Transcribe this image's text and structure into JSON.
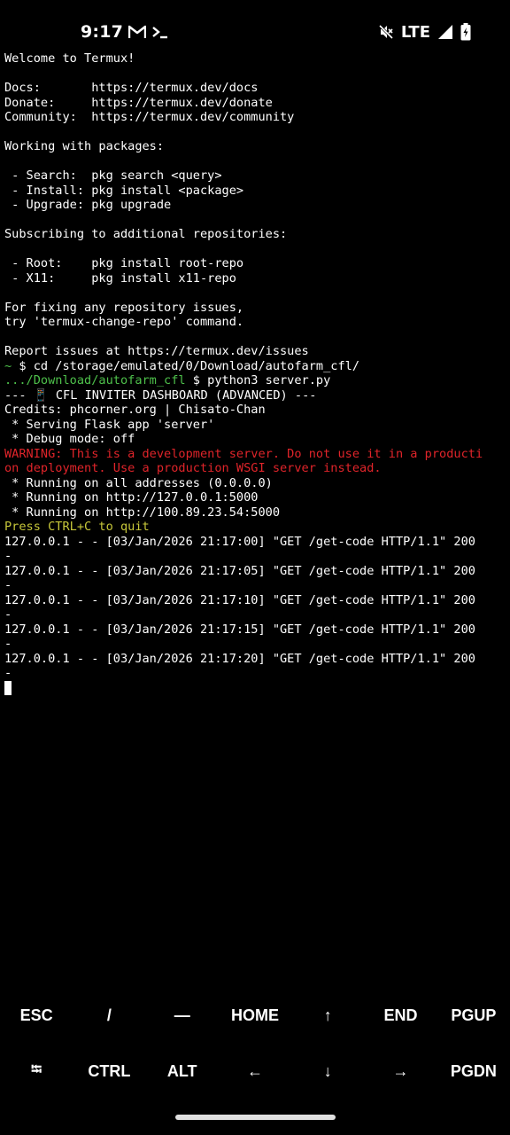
{
  "status_bar": {
    "time": "9:17",
    "network": "LTE",
    "icons": [
      "gmail-icon",
      "terminal-icon",
      "mute-icon",
      "signal-icon",
      "battery-charging-icon"
    ]
  },
  "terminal": {
    "lines": [
      [
        {
          "t": "Welcome to Termux!",
          "c": ""
        }
      ],
      [
        {
          "t": "",
          "c": ""
        }
      ],
      [
        {
          "t": "Docs:       https://termux.dev/docs",
          "c": ""
        }
      ],
      [
        {
          "t": "Donate:     https://termux.dev/donate",
          "c": ""
        }
      ],
      [
        {
          "t": "Community:  https://termux.dev/community",
          "c": ""
        }
      ],
      [
        {
          "t": "",
          "c": ""
        }
      ],
      [
        {
          "t": "Working with packages:",
          "c": ""
        }
      ],
      [
        {
          "t": "",
          "c": ""
        }
      ],
      [
        {
          "t": " - Search:  pkg search <query>",
          "c": ""
        }
      ],
      [
        {
          "t": " - Install: pkg install <package>",
          "c": ""
        }
      ],
      [
        {
          "t": " - Upgrade: pkg upgrade",
          "c": ""
        }
      ],
      [
        {
          "t": "",
          "c": ""
        }
      ],
      [
        {
          "t": "Subscribing to additional repositories:",
          "c": ""
        }
      ],
      [
        {
          "t": "",
          "c": ""
        }
      ],
      [
        {
          "t": " - Root:    pkg install root-repo",
          "c": ""
        }
      ],
      [
        {
          "t": " - X11:     pkg install x11-repo",
          "c": ""
        }
      ],
      [
        {
          "t": "",
          "c": ""
        }
      ],
      [
        {
          "t": "For fixing any repository issues,",
          "c": ""
        }
      ],
      [
        {
          "t": "try 'termux-change-repo' command.",
          "c": ""
        }
      ],
      [
        {
          "t": "",
          "c": ""
        }
      ],
      [
        {
          "t": "Report issues at https://termux.dev/issues",
          "c": ""
        }
      ],
      [
        {
          "t": "~",
          "c": "green"
        },
        {
          "t": " $ cd /storage/emulated/0/Download/autofarm_cfl/",
          "c": ""
        }
      ],
      [
        {
          "t": ".../Download/autofarm_cfl",
          "c": "green"
        },
        {
          "t": " $ python3 server.py",
          "c": ""
        }
      ],
      [
        {
          "t": "--- 📱 CFL INVITER DASHBOARD (ADVANCED) ---",
          "c": ""
        }
      ],
      [
        {
          "t": "Credits: phcorner.org | Chisato-Chan",
          "c": ""
        }
      ],
      [
        {
          "t": " * Serving Flask app 'server'",
          "c": ""
        }
      ],
      [
        {
          "t": " * Debug mode: off",
          "c": ""
        }
      ],
      [
        {
          "t": "WARNING: This is a development server. Do not use it in a producti",
          "c": "red"
        }
      ],
      [
        {
          "t": "on deployment. Use a production WSGI server instead.",
          "c": "red"
        }
      ],
      [
        {
          "t": " * Running on all addresses (0.0.0.0)",
          "c": ""
        }
      ],
      [
        {
          "t": " * Running on http://127.0.0.1:5000",
          "c": ""
        }
      ],
      [
        {
          "t": " * Running on http://100.89.23.54:5000",
          "c": ""
        }
      ],
      [
        {
          "t": "Press CTRL+C to quit",
          "c": "yellow"
        }
      ],
      [
        {
          "t": "127.0.0.1 - - [03/Jan/2026 21:17:00] \"GET /get-code HTTP/1.1\" 200",
          "c": ""
        }
      ],
      [
        {
          "t": "-",
          "c": ""
        }
      ],
      [
        {
          "t": "127.0.0.1 - - [03/Jan/2026 21:17:05] \"GET /get-code HTTP/1.1\" 200",
          "c": ""
        }
      ],
      [
        {
          "t": "-",
          "c": ""
        }
      ],
      [
        {
          "t": "127.0.0.1 - - [03/Jan/2026 21:17:10] \"GET /get-code HTTP/1.1\" 200",
          "c": ""
        }
      ],
      [
        {
          "t": "-",
          "c": ""
        }
      ],
      [
        {
          "t": "127.0.0.1 - - [03/Jan/2026 21:17:15] \"GET /get-code HTTP/1.1\" 200",
          "c": ""
        }
      ],
      [
        {
          "t": "-",
          "c": ""
        }
      ],
      [
        {
          "t": "127.0.0.1 - - [03/Jan/2026 21:17:20] \"GET /get-code HTTP/1.1\" 200",
          "c": ""
        }
      ],
      [
        {
          "t": "-",
          "c": ""
        }
      ]
    ]
  },
  "extra_keys": {
    "row1": [
      "ESC",
      "/",
      "—",
      "HOME",
      "↑",
      "END",
      "PGUP"
    ],
    "row2": [
      "⭾",
      "CTRL",
      "ALT",
      "←",
      "↓",
      "→",
      "PGDN"
    ]
  }
}
